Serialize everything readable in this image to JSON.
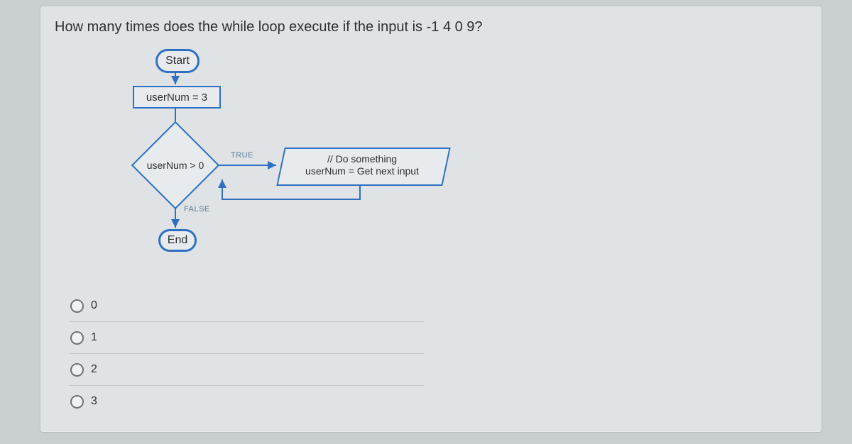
{
  "question": "How many times does the while loop execute if the input is -1 4 0 9?",
  "flow": {
    "start_label": "Start",
    "init_label": "userNum = 3",
    "cond_label": "userNum > 0",
    "body_line1": "// Do something",
    "body_line2": "userNum = Get next input",
    "end_label": "End",
    "true_label": "TRUE",
    "false_label": "FALSE"
  },
  "answers": [
    {
      "value": "0"
    },
    {
      "value": "1"
    },
    {
      "value": "2"
    },
    {
      "value": "3"
    }
  ]
}
